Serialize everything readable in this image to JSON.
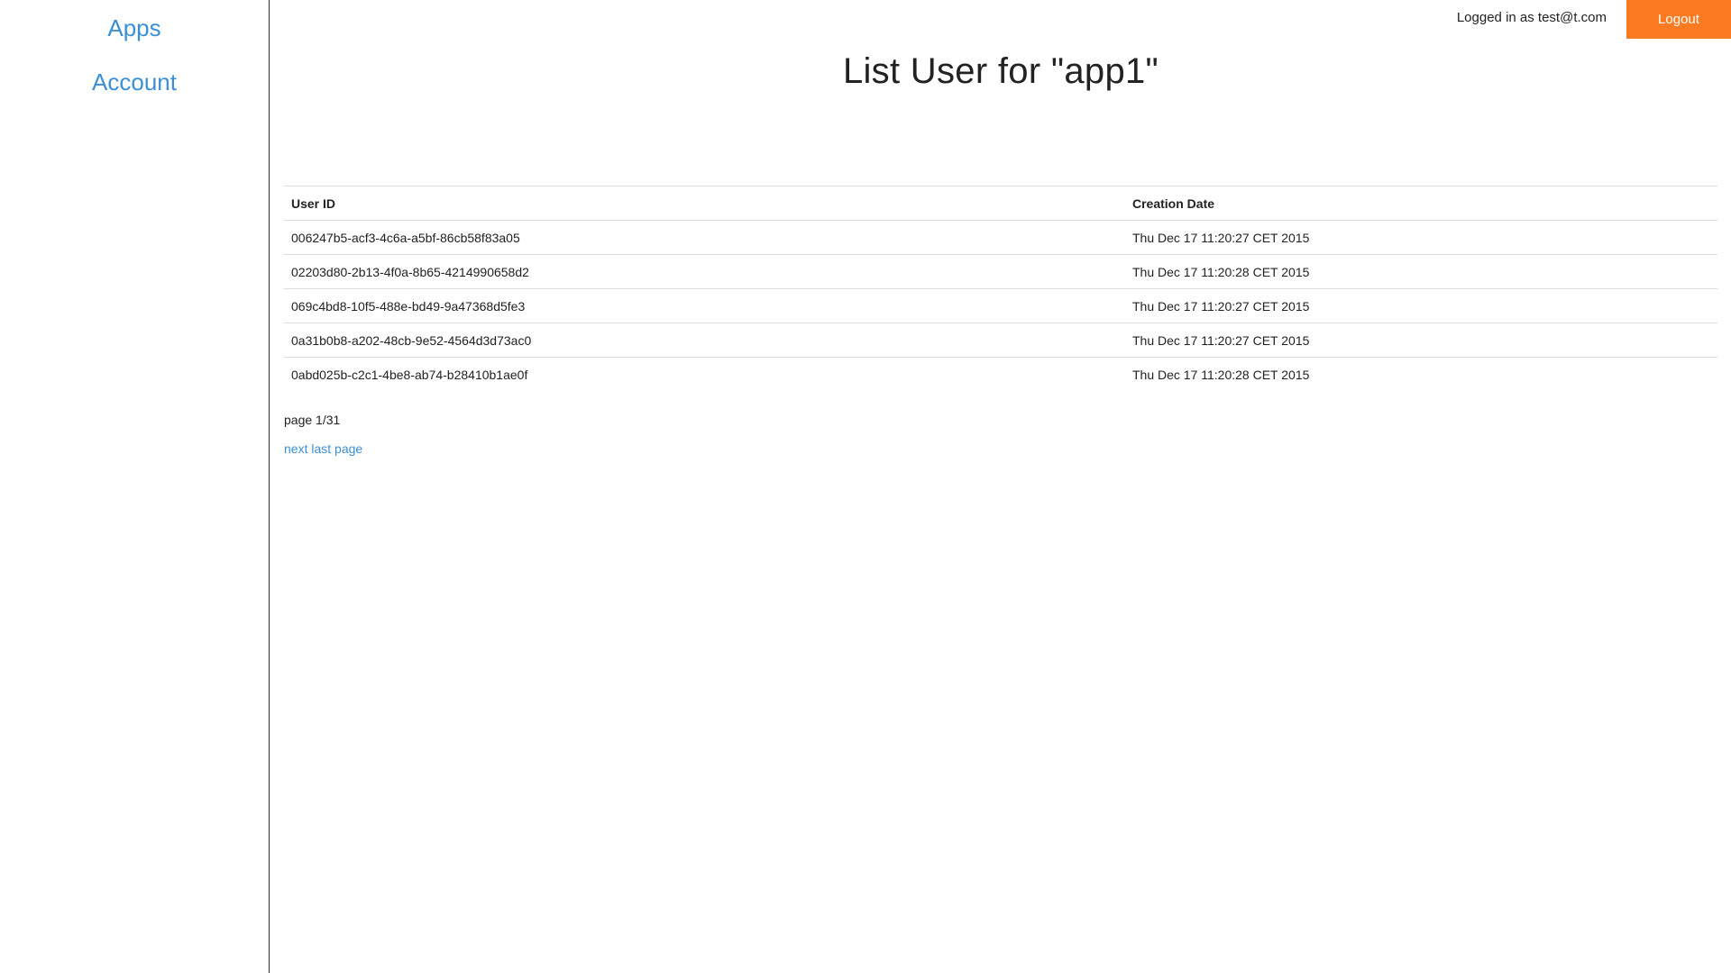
{
  "sidebar": {
    "items": [
      {
        "label": "Apps"
      },
      {
        "label": "Account"
      }
    ]
  },
  "header": {
    "logged_in_text": "Logged in as test@t.com",
    "logout_label": "Logout"
  },
  "main": {
    "title": "List User for \"app1\"",
    "table": {
      "columns": [
        "User ID",
        "Creation Date"
      ],
      "rows": [
        {
          "user_id": "006247b5-acf3-4c6a-a5bf-86cb58f83a05",
          "creation_date": "Thu Dec 17 11:20:27 CET 2015"
        },
        {
          "user_id": "02203d80-2b13-4f0a-8b65-4214990658d2",
          "creation_date": "Thu Dec 17 11:20:28 CET 2015"
        },
        {
          "user_id": "069c4bd8-10f5-488e-bd49-9a47368d5fe3",
          "creation_date": "Thu Dec 17 11:20:27 CET 2015"
        },
        {
          "user_id": "0a31b0b8-a202-48cb-9e52-4564d3d73ac0",
          "creation_date": "Thu Dec 17 11:20:27 CET 2015"
        },
        {
          "user_id": "0abd025b-c2c1-4be8-ab74-b28410b1ae0f",
          "creation_date": "Thu Dec 17 11:20:28 CET 2015"
        }
      ]
    },
    "pagination": {
      "info": "page 1/31",
      "next_label": "next",
      "last_label": "last page"
    }
  },
  "colors": {
    "link": "#3b8fd6",
    "logout_bg": "#fc7a21",
    "sidebar_border": "#333333",
    "row_border": "#dcdcdc"
  }
}
